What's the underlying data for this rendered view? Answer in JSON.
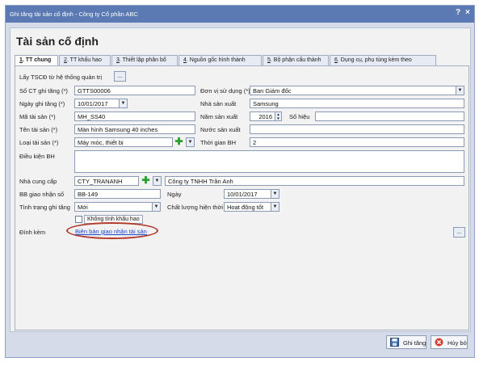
{
  "window": {
    "title": "Ghi tăng tài sản cố định - Công ty Cổ phần ABC",
    "help": "?",
    "close": "×"
  },
  "heading": "Tài sản cố định",
  "tabs": [
    {
      "key": "1",
      "label": ". TT chung"
    },
    {
      "key": "2",
      "label": ". TT khấu hao"
    },
    {
      "key": "3",
      "label": ". Thiết lập phân bổ"
    },
    {
      "key": "4",
      "label": ". Nguồn gốc hình thành"
    },
    {
      "key": "5",
      "label": ". Bộ phận cấu thành"
    },
    {
      "key": "6",
      "label": ". Dụng cụ, phụ tùng kèm theo"
    }
  ],
  "get_from_system": {
    "label": "Lấy TSCĐ từ hệ thống quản trị",
    "button": "..."
  },
  "form": {
    "so_ct": {
      "label": "Số CT ghi tăng (*)",
      "value": "GTTS00006"
    },
    "don_vi": {
      "label": "Đơn vị sử dụng (*)",
      "value": "Ban Giám đốc"
    },
    "ngay_ghi": {
      "label": "Ngày ghi tăng (*)",
      "value": "10/01/2017"
    },
    "nha_sx": {
      "label": "Nhà sản xuất",
      "value": "Samsung"
    },
    "ma_ts": {
      "label": "Mã tài sản (*)",
      "value": "MH_SS40"
    },
    "nam_sx": {
      "label": "Năm sản xuất",
      "value": "2016"
    },
    "so_hieu": {
      "label": "Số hiệu",
      "value": ""
    },
    "ten_ts": {
      "label": "Tên tài sản (*)",
      "value": "Màn hình Samsung 40 inches"
    },
    "nuoc_sx": {
      "label": "Nước sản xuất",
      "value": ""
    },
    "loai_ts": {
      "label": "Loại tài sản (*)",
      "value": "Máy móc, thiết bị"
    },
    "thoi_gian_bh": {
      "label": "Thời gian BH",
      "value": "2"
    },
    "dieu_kien_bh": {
      "label": "Điều kiện BH",
      "value": ""
    },
    "nha_cung_cap": {
      "label": "Nhà cung cấp",
      "code": "CTY_TRANANH",
      "name": "Công ty TNHH Trần Anh"
    },
    "bb_giao_nhan": {
      "label": "BB giao nhận số",
      "value": "BB-149"
    },
    "ngay": {
      "label": "Ngày",
      "value": "10/01/2017"
    },
    "tinh_trang": {
      "label": "Tình trạng ghi tăng",
      "value": "Mới"
    },
    "chat_luong": {
      "label": "Chất lượng hiện thời",
      "value": "Hoạt động tốt"
    },
    "khong_tinh_kh": {
      "label": "Không tính khấu hao",
      "checked": false
    },
    "dinh_kem": {
      "label": "Đính kèm",
      "link": "Biên bản giao nhận tài sản",
      "button": "..."
    }
  },
  "footer": {
    "save": {
      "label": "Ghi tăng"
    },
    "cancel": {
      "label": "Hủy bỏ"
    }
  },
  "colors": {
    "titlebar": "#5b7ab3",
    "link": "#1a44c9",
    "highlight_oval": "#b23a2a"
  }
}
